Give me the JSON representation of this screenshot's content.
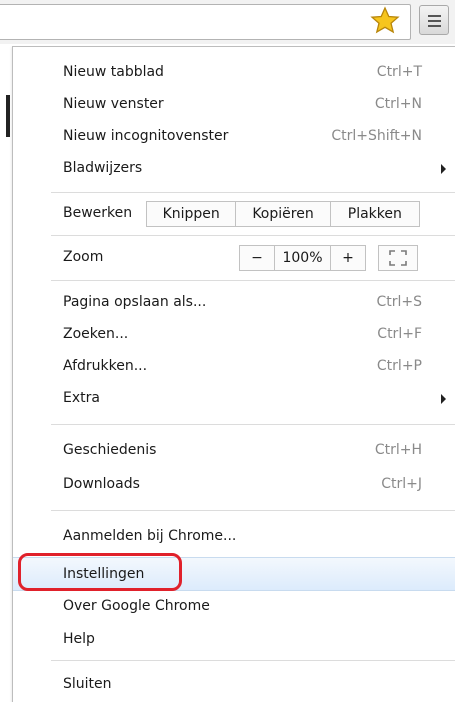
{
  "menu": {
    "items": [
      {
        "label": "Nieuw tabblad",
        "shortcut": "Ctrl+T"
      },
      {
        "label": "Nieuw venster",
        "shortcut": "Ctrl+N"
      },
      {
        "label": "Nieuw incognitovenster",
        "shortcut": "Ctrl+Shift+N"
      },
      {
        "label": "Bladwijzers",
        "shortcut": ""
      }
    ],
    "edit": {
      "label": "Bewerken",
      "cut": "Knippen",
      "copy": "Kopiëren",
      "paste": "Plakken"
    },
    "zoom": {
      "label": "Zoom",
      "minus": "−",
      "value": "100%",
      "plus": "+"
    },
    "page_items": [
      {
        "label": "Pagina opslaan als...",
        "shortcut": "Ctrl+S"
      },
      {
        "label": "Zoeken...",
        "shortcut": "Ctrl+F"
      },
      {
        "label": "Afdrukken...",
        "shortcut": "Ctrl+P"
      },
      {
        "label": "Extra",
        "shortcut": ""
      }
    ],
    "history_items": [
      {
        "label": "Geschiedenis",
        "shortcut": "Ctrl+H"
      },
      {
        "label": "Downloads",
        "shortcut": "Ctrl+J"
      }
    ],
    "signin": {
      "label": "Aanmelden bij Chrome..."
    },
    "bottom_items": [
      {
        "label": "Instellingen"
      },
      {
        "label": "Over Google Chrome"
      },
      {
        "label": "Help"
      }
    ],
    "exit": {
      "label": "Sluiten"
    }
  },
  "icons": {
    "bookmark": "star-icon",
    "menu": "hamburger-menu-icon",
    "fullscreen": "fullscreen-icon",
    "submenu": "chevron-right-icon"
  },
  "colors": {
    "highlight": "#dcebfc",
    "annotation": "#e0212b",
    "star": "#f6c51e"
  }
}
